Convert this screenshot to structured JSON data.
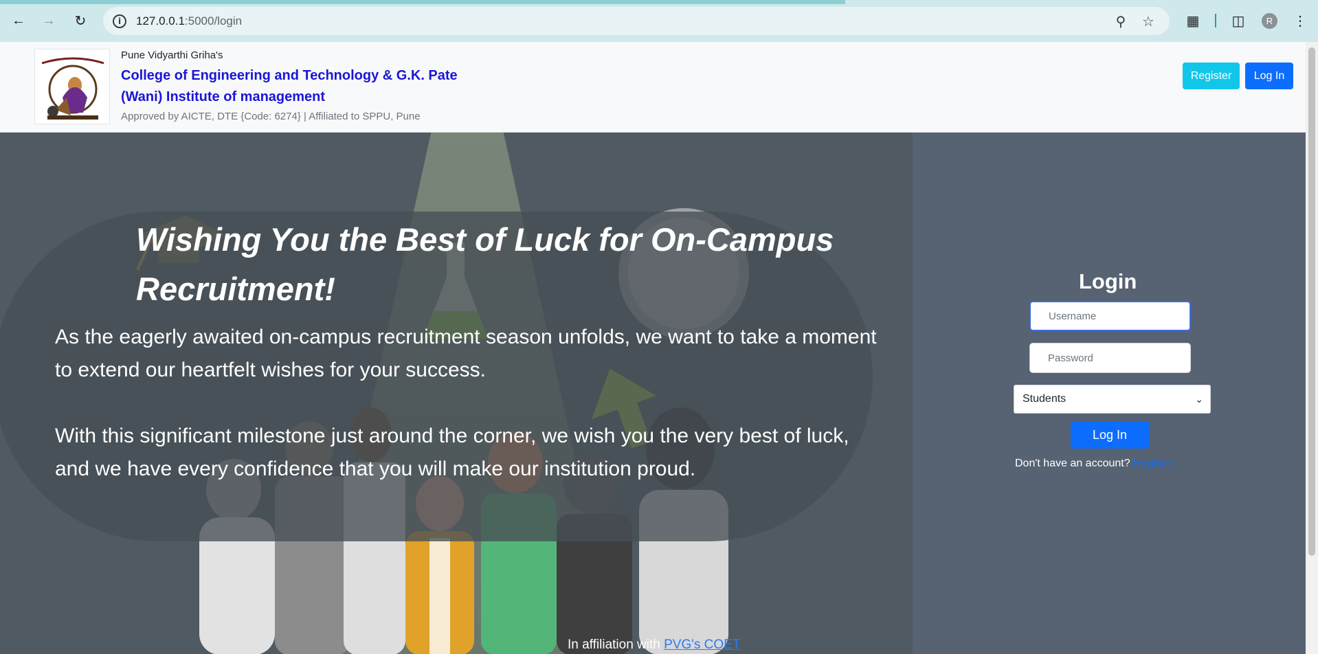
{
  "browser": {
    "url_host": "127.0.0.1",
    "url_path": ":5000/login",
    "profile_initial": "R"
  },
  "header": {
    "org_small": "Pune Vidyarthi Griha's",
    "org_title": "College of Engineering and Technology & G.K. Pate (Wani) Institute of management",
    "approval": "Approved by AICTE, DTE {Code: 6274} | Affiliated to SPPU, Pune",
    "register_label": "Register",
    "login_label": "Log In"
  },
  "hero": {
    "title": "Wishing You the Best of Luck for On-Campus Recruitment!",
    "paragraph_1": "As the eagerly awaited on-campus recruitment season unfolds, we want to take a moment to extend our heartfelt wishes for your success.",
    "paragraph_2": "With this significant milestone just around the corner, we wish you the very best of luck, and we have every confidence that you will make our institution proud."
  },
  "login": {
    "title": "Login",
    "username_placeholder": "Username",
    "password_placeholder": "Password",
    "role_selected": "Students",
    "submit_label": "Log In",
    "account_prompt": "Don't have an account?",
    "register_link": "Register"
  },
  "footer": {
    "text": "In affiliation with",
    "link": "PVG's COET"
  },
  "colors": {
    "primary": "#0d6efd",
    "info": "#12c6ea",
    "title_blue": "#1a16d6",
    "panel_bg": "#576272"
  }
}
